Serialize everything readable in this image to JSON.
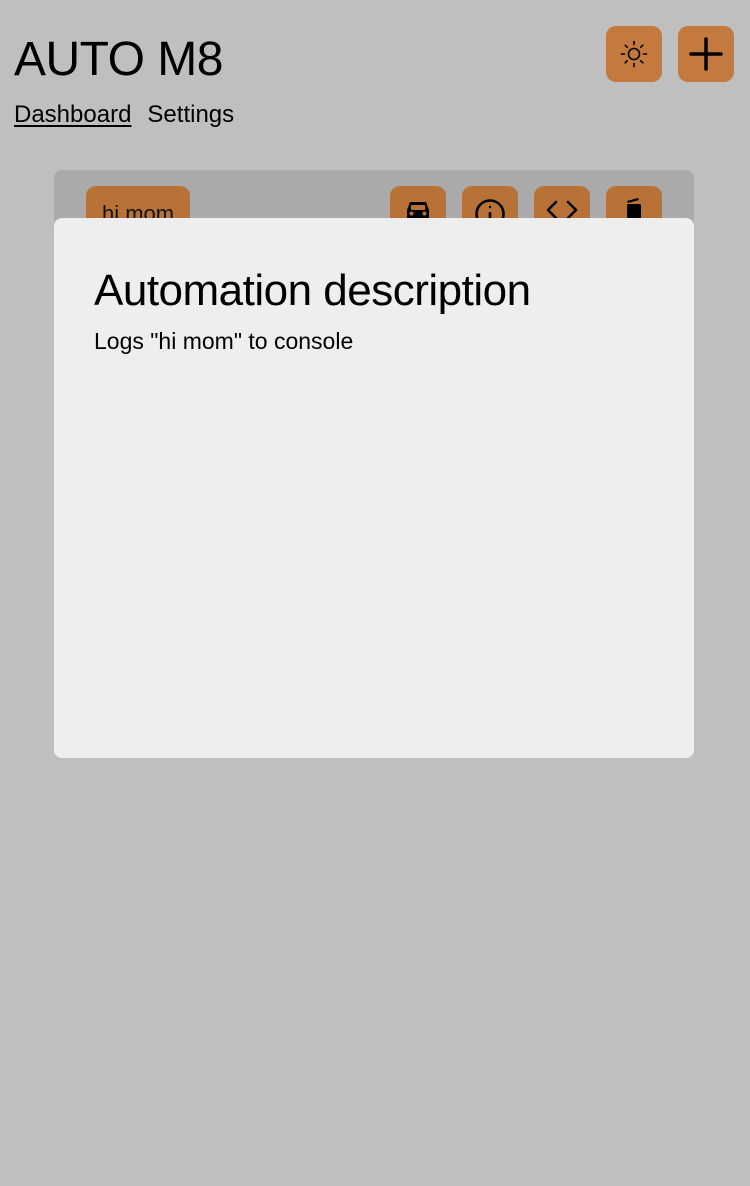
{
  "app": {
    "title": "AUTO M8"
  },
  "nav": {
    "items": [
      {
        "label": "Dashboard",
        "active": true
      },
      {
        "label": "Settings",
        "active": false
      }
    ]
  },
  "header_buttons": {
    "theme_icon": "sun-icon",
    "add_icon": "plus-icon"
  },
  "automation_card": {
    "name": "hi mom",
    "action_icons": [
      "car-icon",
      "info-icon",
      "code-icon",
      "trash-icon"
    ]
  },
  "modal": {
    "title": "Automation description",
    "description": "Logs \"hi mom\" to console"
  },
  "colors": {
    "background": "#bfbfbf",
    "accent": "#c47a3e",
    "card_background": "#aaaaaa",
    "modal_background": "#eeeeee"
  }
}
